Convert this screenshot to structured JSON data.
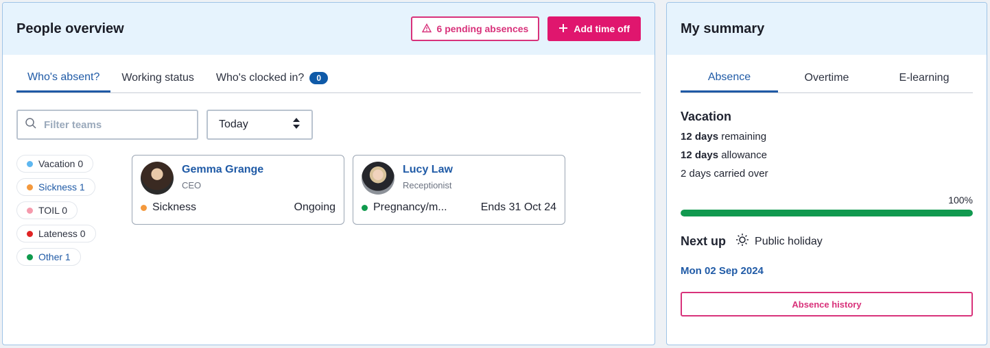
{
  "people_overview": {
    "title": "People overview",
    "pending_button": "6 pending absences",
    "add_button": "Add time off",
    "tabs": [
      {
        "label": "Who's absent?"
      },
      {
        "label": "Working status"
      },
      {
        "label": "Who's clocked in?",
        "badge": "0"
      }
    ],
    "filter_placeholder": "Filter teams",
    "date_select": "Today",
    "legend": [
      {
        "label": "Vacation 0",
        "color": "#5eb7f0",
        "text_color": "#2d3240"
      },
      {
        "label": "Sickness 1",
        "color": "#f4993d",
        "text_color": "#1f5aa6"
      },
      {
        "label": "TOIL 0",
        "color": "#f59aac",
        "text_color": "#2d3240"
      },
      {
        "label": "Lateness 0",
        "color": "#e02424",
        "text_color": "#2d3240"
      },
      {
        "label": "Other 1",
        "color": "#0f9a4d",
        "text_color": "#1f5aa6"
      }
    ],
    "cards": [
      {
        "name": "Gemma Grange",
        "role": "CEO",
        "status": "Sickness",
        "status_color": "#f4993d",
        "detail": "Ongoing"
      },
      {
        "name": "Lucy Law",
        "role": "Receptionist",
        "status": "Pregnancy/m...",
        "status_color": "#0f9a4d",
        "detail": "Ends 31 Oct 24"
      }
    ]
  },
  "summary": {
    "title": "My summary",
    "tabs": [
      {
        "label": "Absence"
      },
      {
        "label": "Overtime"
      },
      {
        "label": "E-learning"
      }
    ],
    "heading": "Vacation",
    "remaining_bold": "12 days",
    "remaining_text": " remaining",
    "allowance_bold": "12 days",
    "allowance_text": " allowance",
    "carried": "2 days carried over",
    "percent": "100%",
    "progress": 1.0,
    "next_label": "Next up",
    "holiday": "Public holiday",
    "date": "Mon 02 Sep 2024",
    "history_button": "Absence history"
  }
}
